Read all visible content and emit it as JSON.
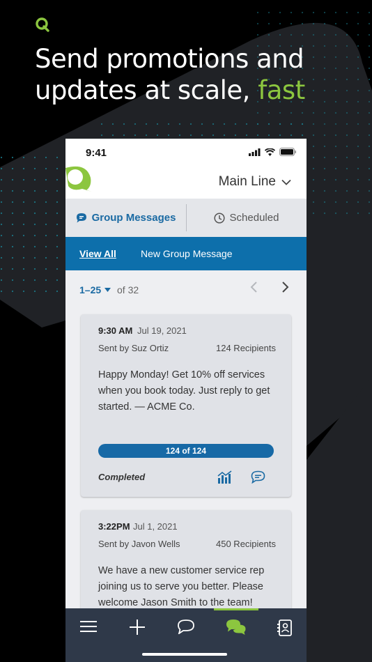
{
  "headline": {
    "line1": "Send promotions and",
    "line2_prefix": "updates at scale, ",
    "line2_accent": "fast"
  },
  "colors": {
    "accent_green": "#8cc63f",
    "brand_blue": "#0d6fab",
    "tabbar_bg": "#2f3949"
  },
  "status_bar": {
    "time": "9:41"
  },
  "app_header": {
    "line_name": "Main Line"
  },
  "tabs": [
    {
      "label": "Group Messages",
      "icon": "chat-bubble-icon",
      "active": true
    },
    {
      "label": "Scheduled",
      "icon": "clock-icon",
      "active": false
    }
  ],
  "subnav": {
    "view_all": "View All",
    "new_group": "New Group Message"
  },
  "pager": {
    "range": "1–25",
    "of": "of 32"
  },
  "messages": [
    {
      "time": "9:30 AM",
      "date": "Jul 19, 2021",
      "sender": "Sent by Suz Ortiz",
      "recipients": "124 Recipients",
      "body": "Happy Monday! Get 10% off services when you book today. Just reply to get started. — ACME Co.",
      "progress_label": "124 of 124",
      "progress_fraction": 1.0,
      "status": "Completed"
    },
    {
      "time": "3:22PM",
      "date": "Jul 1, 2021",
      "sender": "Sent by Javon Wells",
      "recipients": "450 Recipients",
      "body": "We have a new customer service rep joining us to serve you better. Please welcome Jason Smith to the team!"
    }
  ],
  "tab_bar": [
    {
      "icon": "menu-icon"
    },
    {
      "icon": "plus-icon"
    },
    {
      "icon": "chat-icon"
    },
    {
      "icon": "group-chat-icon",
      "active": true
    },
    {
      "icon": "contacts-icon"
    }
  ]
}
